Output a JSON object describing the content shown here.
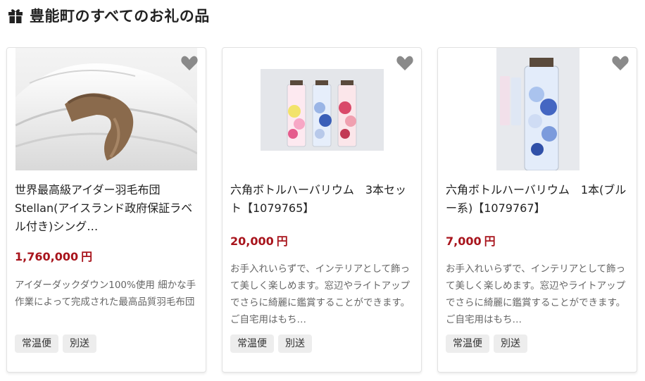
{
  "section": {
    "title": "豊能町のすべてのお礼の品",
    "icon": "gift-icon"
  },
  "products": [
    {
      "title": "世界最高級アイダー羽毛布団Stellan(アイスランド政府保証ラベル付き)シング…",
      "price": "1,760,000",
      "currency": "円",
      "description": "アイダーダックダウン100%使用 細かな手作業によって完成された最高品質羽毛布団",
      "tags": [
        "常温便",
        "別送"
      ],
      "favorite_icon": "heart-icon",
      "image_icon": "down-duvet-photo"
    },
    {
      "title": "六角ボトルハーバリウム　3本セット【1079765】",
      "price": "20,000",
      "currency": "円",
      "description": "お手入れいらずで、インテリアとして飾って美しく楽しめます。窓辺やライトアップでさらに綺麗に鑑賞することができます。ご自宅用はもち…",
      "tags": [
        "常温便",
        "別送"
      ],
      "favorite_icon": "heart-icon",
      "image_icon": "herbarium-three-bottles-photo"
    },
    {
      "title": "六角ボトルハーバリウム　1本(ブルー系)【1079767】",
      "price": "7,000",
      "currency": "円",
      "description": "お手入れいらずで、インテリアとして飾って美しく楽しめます。窓辺やライトアップでさらに綺麗に鑑賞することができます。ご自宅用はもち…",
      "tags": [
        "常温便",
        "別送"
      ],
      "favorite_icon": "heart-icon",
      "image_icon": "herbarium-blue-bottle-photo"
    }
  ],
  "colors": {
    "price": "#a8141c",
    "heart": "#8a8a8a",
    "tag_bg": "#ededed"
  }
}
